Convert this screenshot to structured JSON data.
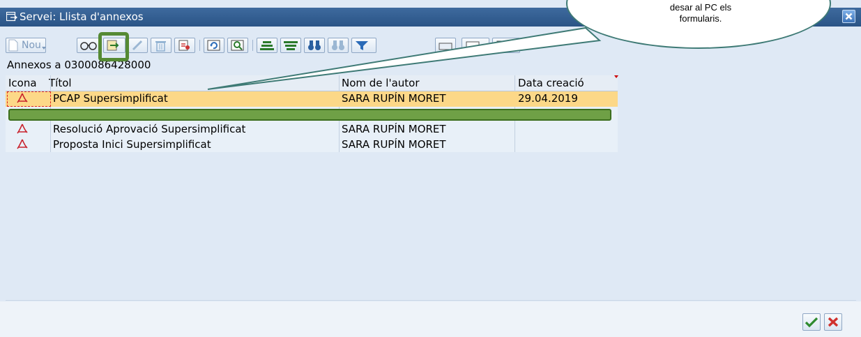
{
  "window": {
    "title": "Servei: Llista d'annexos"
  },
  "toolbar": {
    "new_label": "Nou",
    "buttons": [
      "new-button",
      "display-button",
      "save-to-pc-button",
      "edit-button",
      "delete-button",
      "attributes-button",
      "refresh-button",
      "find-button",
      "sort-ascending-button",
      "filter-button",
      "search-button",
      "find-next-button",
      "set-filter-button",
      "print-button",
      "export-button",
      "layout-button"
    ]
  },
  "list": {
    "header": "Annexos a 0300086428000",
    "columns": [
      "Icona",
      "Títol",
      "Nom de l'autor",
      "Data creació"
    ],
    "rows": [
      {
        "icon": "pdf-icon",
        "title": "PCAP Supersimplificat",
        "author": "SARA RUPÍN MORET",
        "date": "29.04.2019",
        "selected": true
      },
      {
        "icon": "pdf-icon",
        "title": "",
        "author": "",
        "date": "",
        "selected": false
      },
      {
        "icon": "pdf-icon",
        "title": "Resolució Aprovació Supersimplificat",
        "author": "SARA RUPÍN MORET",
        "date": "",
        "selected": false
      },
      {
        "icon": "pdf-icon",
        "title": "Proposta Inici Supersimplificat",
        "author": "SARA RUPÍN MORET",
        "date": "",
        "selected": false
      }
    ]
  },
  "callout": {
    "line1": "desar al PC els",
    "line2": "formularis."
  },
  "colors": {
    "titlebar": "#2a5486",
    "selected_row": "#fcd888",
    "highlight_green": "#558a34",
    "callout_border": "#3e7a75"
  }
}
